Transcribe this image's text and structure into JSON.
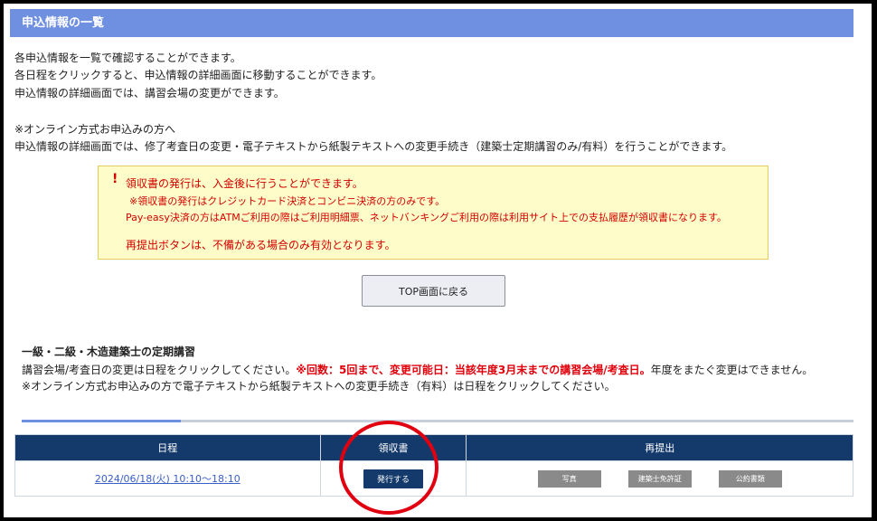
{
  "header": {
    "title": "申込情報の一覧"
  },
  "intro": {
    "line1": "各申込情報を一覧で確認することができます。",
    "line2": "各日程をクリックすると、申込情報の詳細画面に移動することができます。",
    "line3": "申込情報の詳細画面では、講習会場の変更ができます。",
    "line4": "※オンライン方式お申込みの方へ",
    "line5": "申込情報の詳細画面では、修了考査日の変更・電子テキストから紙製テキストへの変更手続き（建築士定期講習のみ/有料）を行うことができます。"
  },
  "notice": {
    "mark": "!",
    "line1": "領収書の発行は、入金後に行うことができます。",
    "line2": "※領収書の発行はクレジットカード決済とコンビニ決済の方のみです。",
    "line3": "Pay-easy決済の方はATMご利用の際はご利用明細票、ネットバンキングご利用の際は利用サイト上での支払履歴が領収書になります。",
    "line4": "再提出ボタンは、不備がある場合のみ有効となります。"
  },
  "top_button": {
    "label": "TOP画面に戻る"
  },
  "section": {
    "title": "一級・二級・木造建築士の定期講習",
    "desc_a": "講習会場/考査日の変更は日程をクリックしてください。",
    "desc_red": "※回数：5回まで、変更可能日：当該年度3月末までの講習会場/考査日。",
    "desc_b": "年度をまたぐ変更はできません。",
    "desc_c": "※オンライン方式お申込みの方で電子テキストから紙製テキストへの変更手続き（有料）は日程をクリックしてください。"
  },
  "table": {
    "headers": [
      "日程",
      "領収書",
      "再提出"
    ],
    "row": {
      "date": "2024/06/18(火) 10:10～18:10",
      "issue_label": "発行する",
      "resubmit": [
        "写真",
        "建築士免許証",
        "公約書類"
      ]
    }
  },
  "colors": {
    "header_bg": "#6f8fe0",
    "table_header_bg": "#143a6b",
    "notice_text": "#d20000",
    "highlight_circle": "#e00010"
  }
}
